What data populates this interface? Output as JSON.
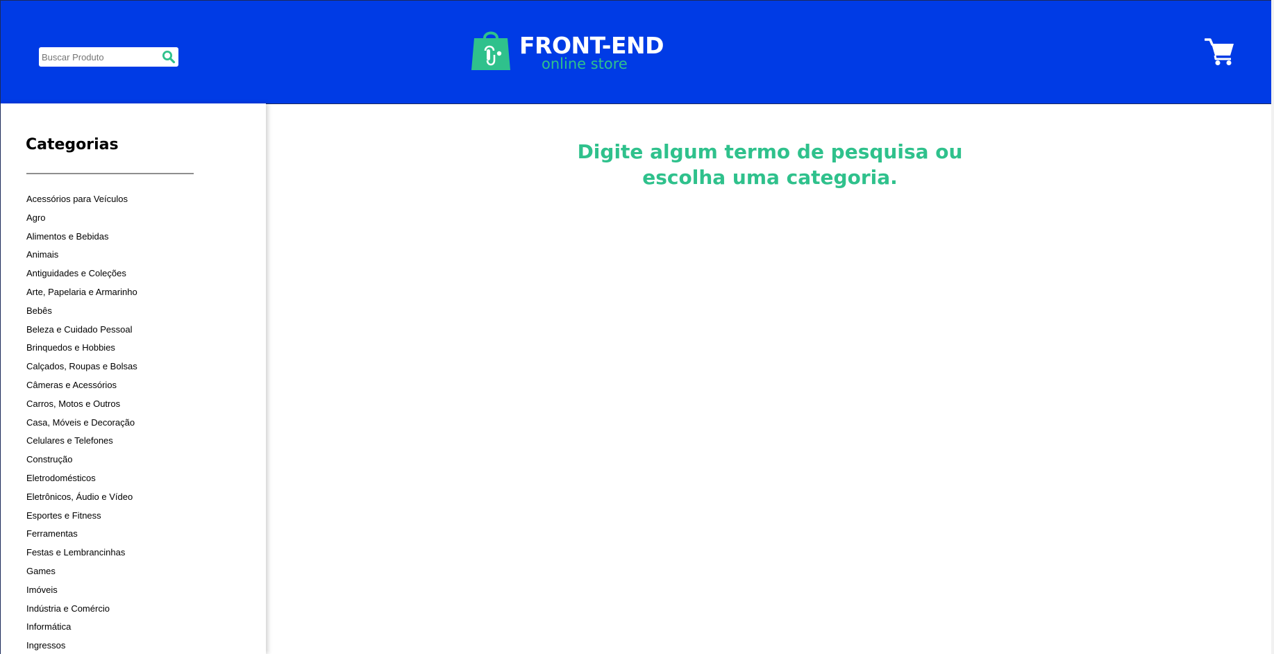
{
  "header": {
    "search": {
      "placeholder": "Buscar Produto",
      "value": ""
    },
    "logo": {
      "title": "FRONT-END",
      "subtitle": "online store"
    },
    "icons": {
      "search": "search-icon",
      "cart": "cart-icon",
      "logo": "shopping-bag-icon"
    },
    "colors": {
      "background": "#003be5",
      "accent": "#2fc18c"
    }
  },
  "sidebar": {
    "title": "Categorias",
    "categories": [
      "Acessórios para Veículos",
      "Agro",
      "Alimentos e Bebidas",
      "Animais",
      "Antiguidades e Coleções",
      "Arte, Papelaria e Armarinho",
      "Bebês",
      "Beleza e Cuidado Pessoal",
      "Brinquedos e Hobbies",
      "Calçados, Roupas e Bolsas",
      "Câmeras e Acessórios",
      "Carros, Motos e Outros",
      "Casa, Móveis e Decoração",
      "Celulares e Telefones",
      "Construção",
      "Eletrodomésticos",
      "Eletrônicos, Áudio e Vídeo",
      "Esportes e Fitness",
      "Ferramentas",
      "Festas e Lembrancinhas",
      "Games",
      "Imóveis",
      "Indústria e Comércio",
      "Informática",
      "Ingressos"
    ]
  },
  "main": {
    "message_line1": "Digite algum termo de pesquisa ou",
    "message_line2": "escolha uma categoria."
  }
}
